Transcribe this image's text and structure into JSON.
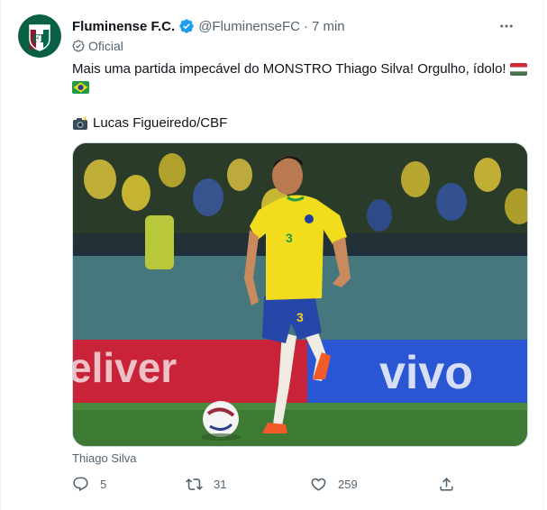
{
  "account": {
    "name": "Fluminense F.C.",
    "handle": "@FluminenseFC",
    "separator": "·",
    "time": "7 min",
    "label": "Oficial"
  },
  "tweet": {
    "text": "Mais uma partida impecável do MONSTRO Thiago Silva! Orgulho, ídolo!",
    "credit": "Lucas Figueiredo/CBF",
    "media_caption": "Thiago Silva"
  },
  "stats": {
    "replies": "5",
    "retweets": "31",
    "likes": "259"
  },
  "colors": {
    "verified": "#1d9bf0",
    "muted": "#536471",
    "text": "#0f1419",
    "fluminense_green": "#006a4e",
    "fluminense_maroon": "#8b1a2b",
    "brazil_yellow": "#f6d51b",
    "brazil_blue": "#1f3f99"
  },
  "icons": {
    "more": "more-horizontal-icon",
    "verified": "verified-badge-icon",
    "official": "official-badge-icon",
    "camera": "camera-flash-icon",
    "reply": "reply-icon",
    "retweet": "retweet-icon",
    "like": "heart-icon",
    "share": "share-icon"
  }
}
